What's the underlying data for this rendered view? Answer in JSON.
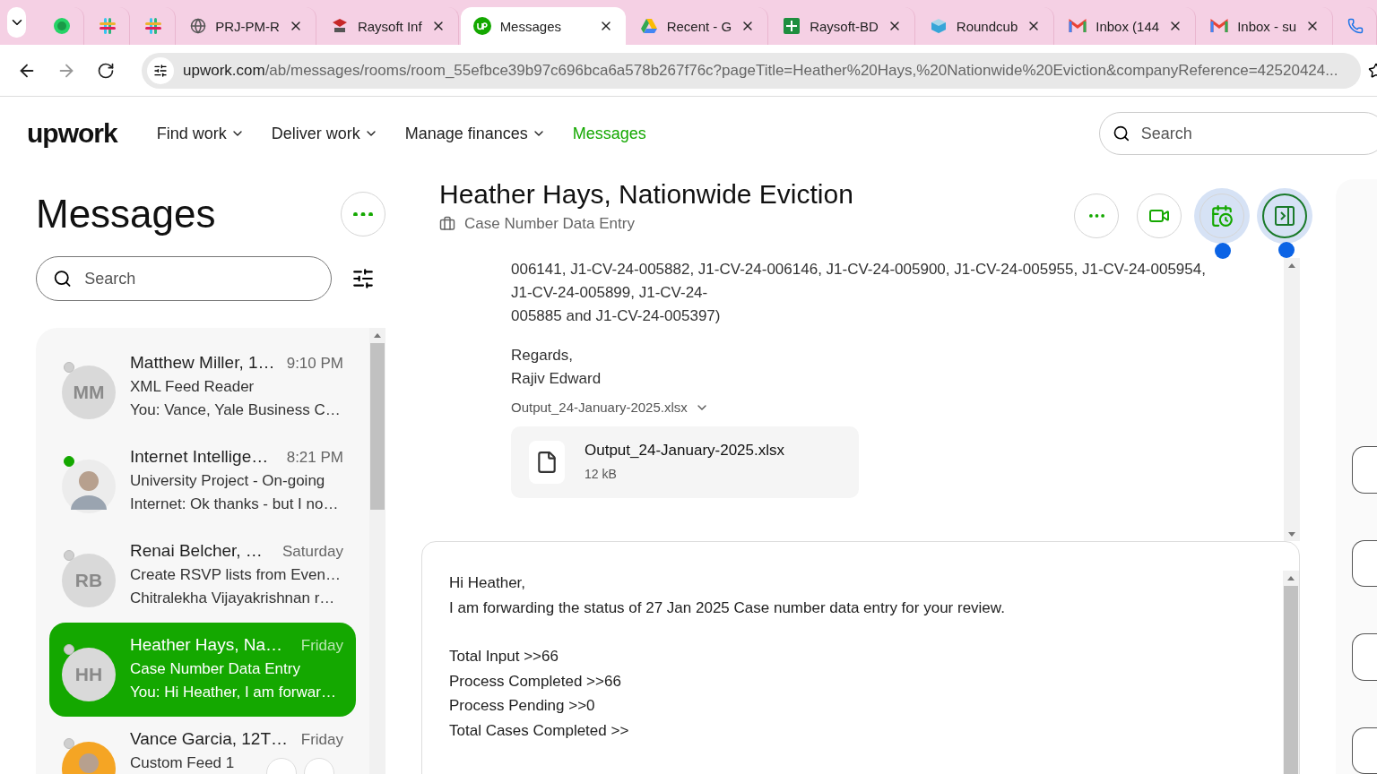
{
  "browser": {
    "tabs": [
      {
        "selected": false
      },
      {
        "selected": false
      },
      {
        "selected": false
      },
      {
        "title": "PRJ-PM-R",
        "selected": false
      },
      {
        "title": "Raysoft Inf",
        "selected": false
      },
      {
        "title": "Messages",
        "selected": true
      },
      {
        "title": "Recent - G",
        "selected": false
      },
      {
        "title": "Raysoft-BD",
        "selected": false
      },
      {
        "title": "Roundcub",
        "selected": false
      },
      {
        "title": "Inbox (144",
        "selected": false
      },
      {
        "title": "Inbox - su",
        "selected": false
      },
      {
        "selected": false
      }
    ],
    "url_host": "upwork.com",
    "url_path": "/ab/messages/rooms/room_55efbce39b97c696bca6a578b267f76c?pageTitle=Heather%20Hays,%20Nationwide%20Eviction&companyReference=42520424..."
  },
  "nav": {
    "logo": "upwork",
    "items": [
      {
        "label": "Find work",
        "dropdown": true,
        "selected": false
      },
      {
        "label": "Deliver work",
        "dropdown": true,
        "selected": false
      },
      {
        "label": "Manage finances",
        "dropdown": true,
        "selected": false
      },
      {
        "label": "Messages",
        "dropdown": false,
        "selected": true
      }
    ],
    "search": {
      "placeholder": "Search"
    }
  },
  "sidebar": {
    "title": "Messages",
    "search": {
      "placeholder": "Search"
    },
    "conversations": [
      {
        "initials": "MM",
        "online": false,
        "selected": false,
        "name": "Matthew Miller, 1…",
        "time": "9:10 PM",
        "subject": "XML Feed Reader",
        "preview": "You: Vance, Yale Business C…"
      },
      {
        "online": true,
        "selected": false,
        "name": "Internet Intellige…",
        "time": "8:21 PM",
        "subject": "University Project - On-going",
        "preview": "Internet: Ok thanks - but I no…"
      },
      {
        "initials": "RB",
        "online": false,
        "selected": false,
        "name": "Renai Belcher, …",
        "time": "Saturday",
        "subject": "Create RSVP lists from Even…",
        "preview": "Chitralekha Vijayakrishnan r…"
      },
      {
        "initials": "HH",
        "online": false,
        "selected": true,
        "name": "Heather Hays, Na…",
        "time": "Friday",
        "subject": "Case Number Data Entry",
        "preview": "You: Hi Heather, I am forwar…"
      },
      {
        "online": false,
        "selected": false,
        "name": "Vance Garcia, 12T…",
        "time": "Friday",
        "subject": "Custom Feed 1"
      }
    ]
  },
  "chat": {
    "title": "Heather Hays, Nationwide Eviction",
    "subtitle": "Case Number Data Entry",
    "message": [
      [
        "006141, J1-CV-24-005882, J1-CV-24-006146, J1-CV-24-005900, J1-CV-24-005955, J1-CV-24-005954,",
        "J1-CV-24-005899, J1-CV-24-",
        "005885 and J1-CV-24-005397)"
      ],
      [
        "Regards,",
        "Rajiv Edward"
      ]
    ],
    "attachment_label": "Output_24-January-2025.xlsx",
    "file": {
      "name": "Output_24-January-2025.xlsx",
      "size": "12 kB"
    },
    "compose": [
      [
        "Hi Heather,",
        "I am forwarding the status of 27 Jan 2025 Case number data entry for your review."
      ],
      [
        "Total Input >>66",
        "Process Completed >>66",
        "Process Pending >>0",
        "Total Cases Completed >>"
      ]
    ]
  }
}
